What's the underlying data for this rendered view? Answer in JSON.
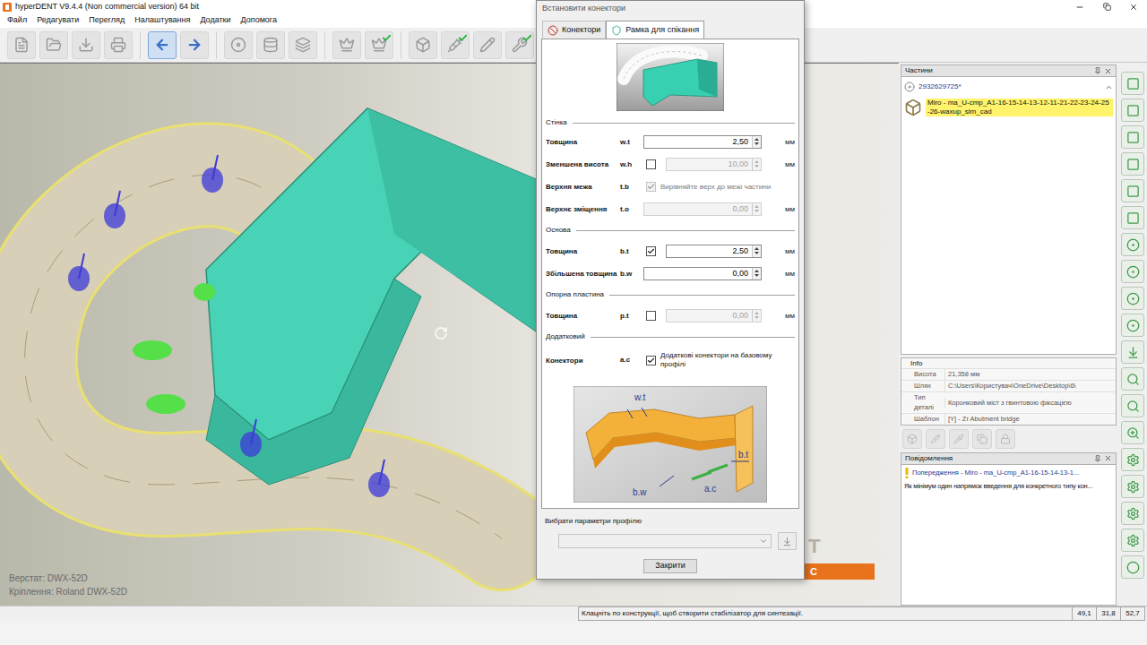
{
  "window": {
    "title": "hyperDENT V9.4.4 (Non commercial version) 64 bit"
  },
  "menu": [
    "Файл",
    "Редагувати",
    "Перегляд",
    "Налаштування",
    "Додатки",
    "Допомога"
  ],
  "toolbar": [
    [
      {
        "kind": "new",
        "selected": false,
        "done": false
      },
      {
        "kind": "open",
        "selected": false,
        "done": false
      },
      {
        "kind": "save",
        "selected": false,
        "done": false
      },
      {
        "kind": "print",
        "selected": false,
        "done": false
      }
    ],
    [
      {
        "kind": "back",
        "selected": true,
        "done": false
      },
      {
        "kind": "forward",
        "selected": false,
        "done": false
      }
    ],
    [
      {
        "kind": "disk",
        "selected": false,
        "done": false
      },
      {
        "kind": "stock",
        "selected": false,
        "done": false
      },
      {
        "kind": "fixture",
        "selected": false,
        "done": false
      }
    ],
    [
      {
        "kind": "crown",
        "selected": false,
        "done": false
      },
      {
        "kind": "crown",
        "selected": false,
        "done": true
      }
    ],
    [
      {
        "kind": "tooth",
        "selected": false,
        "done": false
      },
      {
        "kind": "implant",
        "selected": false,
        "done": true
      },
      {
        "kind": "pencil",
        "selected": false,
        "done": false
      },
      {
        "kind": "mill",
        "selected": false,
        "done": true
      },
      {
        "kind": "tooth",
        "selected": false,
        "done": true
      }
    ]
  ],
  "viewport": {
    "machine": "Верстат: DWX-52D",
    "fixture": "Кріплення: Roland DWX-52D",
    "watermark": "T",
    "banner": "C"
  },
  "dialog": {
    "title": "Встановити конектори",
    "tabs": [
      {
        "label": "Конектори",
        "kind": "connectors",
        "selected": false
      },
      {
        "label": "Рамка для спікання",
        "kind": "frame",
        "selected": true
      }
    ],
    "sections": [
      {
        "title": "Стінка",
        "rows": [
          {
            "kind": "field",
            "label": "Товщина",
            "code": "w.t",
            "value": "2,50",
            "unit": "мм",
            "disabled": false
          },
          {
            "kind": "check-field",
            "label": "Зменшена висота",
            "code": "w.h",
            "checked": false,
            "value": "10,00",
            "unit": "мм",
            "disabled": true
          },
          {
            "kind": "check-text",
            "label": "Верхня межа",
            "code": "t.b",
            "checked": true,
            "text": "Вирівняйте верх до межі частини",
            "disabled": true
          },
          {
            "kind": "field",
            "label": "Верхнє зміщення",
            "code": "t.o",
            "value": "0,00",
            "unit": "мм",
            "disabled": true
          }
        ]
      },
      {
        "title": "Основа",
        "rows": [
          {
            "kind": "check-field",
            "label": "Товщина",
            "code": "b.t",
            "checked": true,
            "value": "2,50",
            "unit": "мм",
            "disabled": false
          },
          {
            "kind": "field",
            "label": "Збільшена товщина",
            "code": "b.w",
            "value": "0,00",
            "unit": "мм",
            "disabled": false
          }
        ]
      },
      {
        "title": "Опорна пластина",
        "rows": [
          {
            "kind": "check-field",
            "label": "Товщина",
            "code": "p.t",
            "checked": false,
            "value": "0,00",
            "unit": "мм",
            "disabled": true
          }
        ]
      },
      {
        "title": "Додатковий",
        "rows": [
          {
            "kind": "check-text",
            "label": "Конектори",
            "code": "a.c",
            "checked": true,
            "text": "Додаткові конектори на базовому профілі",
            "disabled": false
          }
        ]
      }
    ],
    "diagram_labels": [
      "w.t",
      "a.c",
      "b.t",
      "b.w"
    ],
    "profile": {
      "label": "Вибрати параметри профілю",
      "value": ""
    },
    "close": "Закрити"
  },
  "parts_panel": {
    "title": "Частини",
    "group": {
      "label": "2932629725*",
      "expanded": true
    },
    "items": [
      {
        "label": "Miro  - ma_U-cmp_A1-16-15-14-13-12-11-21-22-23-24-25-26-waxup_slm_cad",
        "selected": true
      }
    ]
  },
  "info": {
    "title": "Info",
    "rows": [
      {
        "label": "Висота",
        "value": "21,358 мм"
      },
      {
        "label": "Шлях",
        "value": "C:\\Users\\Користувач\\OneDrive\\Desktop\\6\\"
      },
      {
        "label": "Тип деталі",
        "value": "Коронковий міст з гвинтовою фіксацією"
      },
      {
        "label": "Шаблон",
        "value": "[Y] - Zr Abutment bridge"
      }
    ]
  },
  "part_tools": [
    {
      "kind": "tooth",
      "disabled": true
    },
    {
      "kind": "implant",
      "disabled": true
    },
    {
      "kind": "pipette",
      "disabled": true
    },
    {
      "kind": "copy",
      "disabled": true
    },
    {
      "kind": "lock",
      "disabled": true
    }
  ],
  "messages_panel": {
    "title": "Повідомлення",
    "messages": [
      {
        "title": "Попередження - Miro  - ma_U-cmp_A1-16-15-14-13-1...",
        "body": "Як мінімум один напрямок введення для конкретного типу кон..."
      }
    ]
  },
  "right_toolbar": [
    {
      "kind": "view"
    },
    {
      "kind": "view"
    },
    {
      "kind": "view"
    },
    {
      "kind": "view"
    },
    {
      "kind": "view"
    },
    {
      "kind": "view"
    },
    {
      "kind": "dot"
    },
    {
      "kind": "dot"
    },
    {
      "kind": "dot"
    },
    {
      "kind": "dot"
    },
    {
      "kind": "export"
    },
    {
      "kind": "search"
    },
    {
      "kind": "search"
    },
    {
      "kind": "zoom"
    },
    {
      "kind": "tool"
    },
    {
      "kind": "tool"
    },
    {
      "kind": "tool"
    },
    {
      "kind": "tool"
    },
    {
      "kind": "empty"
    }
  ],
  "status_bar": {
    "hint": "Клацніть по конструкції, щоб створити стабілізатор для синтезації.",
    "coords": [
      "49,1",
      "31,8",
      "52,7"
    ]
  }
}
